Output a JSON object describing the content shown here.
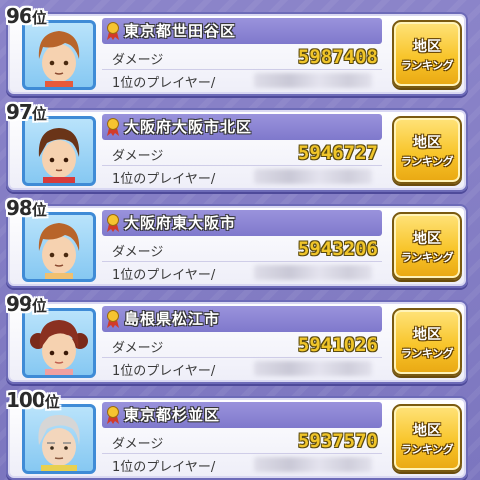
{
  "ranking": {
    "damage_label": "ダメージ",
    "top_player_label": "1位のプレイヤー/",
    "button_line1": "地区",
    "button_line2": "ランキング",
    "rank_suffix": "位",
    "entries": [
      {
        "rank": "96",
        "area": "東京都世田谷区",
        "damage": "5987408",
        "avatar": "boy-brown-hair"
      },
      {
        "rank": "97",
        "area": "大阪府大阪市北区",
        "damage": "5946727",
        "avatar": "boy-red-shirt"
      },
      {
        "rank": "98",
        "area": "大阪府東大阪市",
        "damage": "5943206",
        "avatar": "boy-brown-hair"
      },
      {
        "rank": "99",
        "area": "島根県松江市",
        "damage": "5941026",
        "avatar": "girl-pigtails"
      },
      {
        "rank": "100",
        "area": "東京都杉並区",
        "damage": "5937570",
        "avatar": "elder-gray-hair"
      }
    ]
  },
  "colors": {
    "background": "#7c76bf",
    "title_bar": "#8a84d4",
    "damage_value": "#f0c52a",
    "button": "#f8c52b",
    "avatar_frame": "#3f8bd6"
  }
}
